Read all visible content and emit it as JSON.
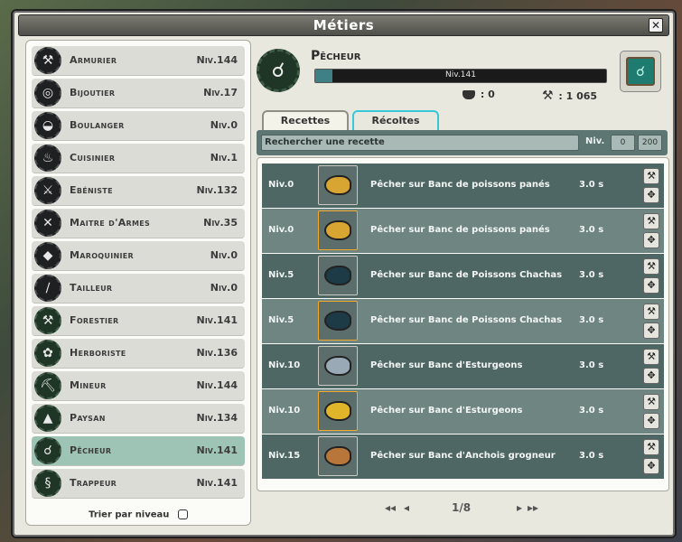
{
  "window": {
    "title": "Métiers"
  },
  "sidebar": {
    "jobs": [
      {
        "name": "Armurier",
        "level": "Niv.144",
        "icon": "anvil-icon",
        "glyph": "⚒"
      },
      {
        "name": "Bijoutier",
        "level": "Niv.17",
        "icon": "ring-icon",
        "glyph": "◎"
      },
      {
        "name": "Boulanger",
        "level": "Niv.0",
        "icon": "bread-icon",
        "glyph": "◒"
      },
      {
        "name": "Cuisinier",
        "level": "Niv.1",
        "icon": "pot-icon",
        "glyph": "♨"
      },
      {
        "name": "Ebéniste",
        "level": "Niv.132",
        "icon": "saw-icon",
        "glyph": "⚔"
      },
      {
        "name": "Maitre d'Armes",
        "level": "Niv.35",
        "icon": "swords-icon",
        "glyph": "✕"
      },
      {
        "name": "Maroquinier",
        "level": "Niv.0",
        "icon": "bag-icon",
        "glyph": "◆"
      },
      {
        "name": "Tailleur",
        "level": "Niv.0",
        "icon": "needle-icon",
        "glyph": "∕"
      },
      {
        "name": "Forestier",
        "level": "Niv.141",
        "icon": "axe-icon",
        "glyph": "⚒"
      },
      {
        "name": "Herboriste",
        "level": "Niv.136",
        "icon": "leaf-icon",
        "glyph": "✿"
      },
      {
        "name": "Mineur",
        "level": "Niv.144",
        "icon": "pickaxe-icon",
        "glyph": "⛏"
      },
      {
        "name": "Paysan",
        "level": "Niv.134",
        "icon": "scythe-icon",
        "glyph": "▲"
      },
      {
        "name": "Pêcheur",
        "level": "Niv.141",
        "icon": "fishhook-icon",
        "glyph": "☌"
      },
      {
        "name": "Trappeur",
        "level": "Niv.141",
        "icon": "trap-icon",
        "glyph": "§"
      }
    ],
    "sort_label": "Trier par niveau"
  },
  "job": {
    "title": "Pêcheur",
    "level_text": "Niv.141",
    "xp_progress": 0.06,
    "stat1": ": 0",
    "stat2": ": 1 065"
  },
  "tabs": [
    "Recettes",
    "Récoltes"
  ],
  "search": {
    "placeholder": "Rechercher une recette",
    "niv_label": "Niv.",
    "min": "0",
    "max": "200"
  },
  "recipes": [
    {
      "level": "Niv.0",
      "name": "Pêcher sur Banc de poissons panés",
      "time": "3.0 s",
      "color": "#d9a532"
    },
    {
      "level": "Niv.0",
      "name": "Pêcher sur Banc de poissons panés",
      "time": "3.0 s",
      "color": "#d9a532"
    },
    {
      "level": "Niv.5",
      "name": "Pêcher sur Banc de Poissons Chachas",
      "time": "3.0 s",
      "color": "#1c3b46"
    },
    {
      "level": "Niv.5",
      "name": "Pêcher sur Banc de Poissons Chachas",
      "time": "3.0 s",
      "color": "#1c3b46"
    },
    {
      "level": "Niv.10",
      "name": "Pêcher sur Banc d'Esturgeons",
      "time": "3.0 s",
      "color": "#9aa9b6"
    },
    {
      "level": "Niv.10",
      "name": "Pêcher sur Banc d'Esturgeons",
      "time": "3.0 s",
      "color": "#e0b52a"
    },
    {
      "level": "Niv.15",
      "name": "Pêcher sur Banc d'Anchois grogneur",
      "time": "3.0 s",
      "color": "#b8763a"
    }
  ],
  "pagination": {
    "label": "1/8"
  }
}
